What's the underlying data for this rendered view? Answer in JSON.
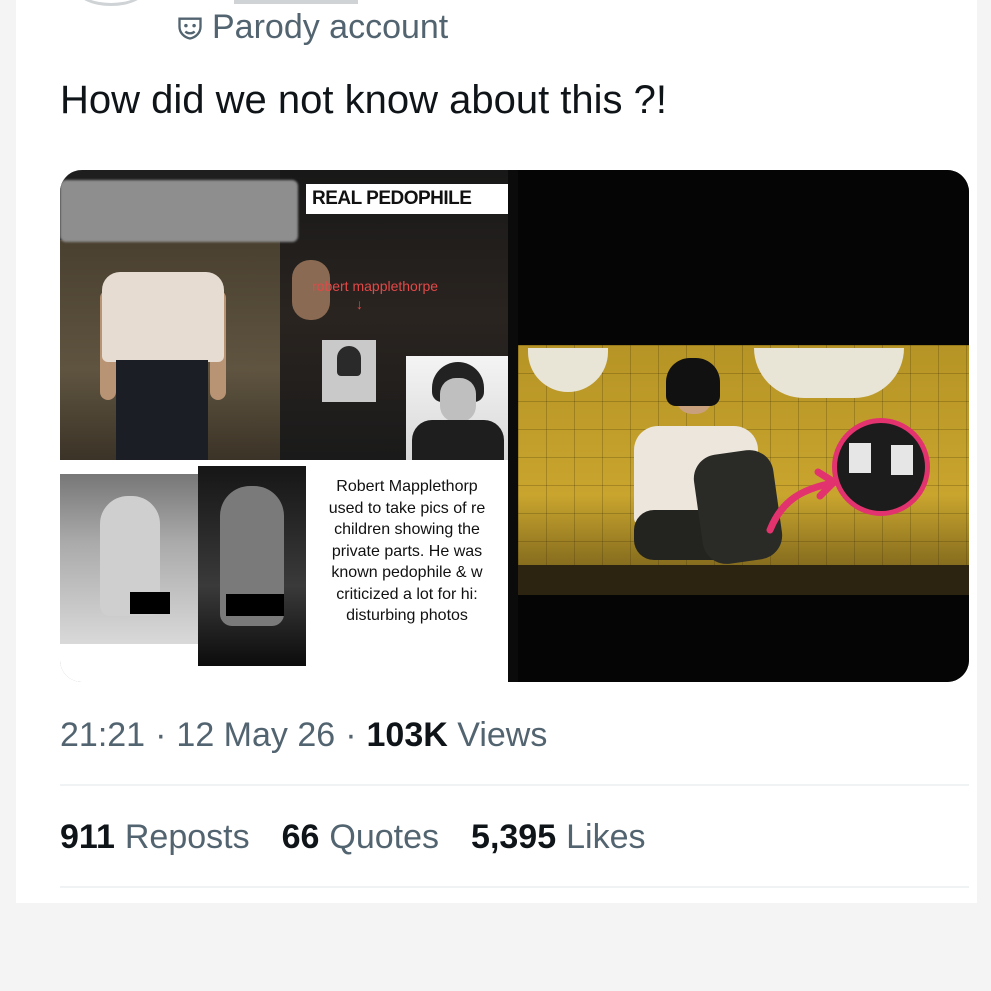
{
  "post": {
    "badge_text": "Parody account",
    "badge_icon": "parody-mask-icon",
    "text": "How did we not know about this ?!",
    "time": "21:21",
    "date": "12 May 26",
    "views_count": "103K",
    "views_label": "Views",
    "separator": "·"
  },
  "media": {
    "left_image": {
      "header_label": "REAL PEDOPHILE",
      "name_label": "robert mapplethorpe",
      "arrow_label": "↓",
      "caption": "Robert Mapplethorp\nused to take pics of re\nchildren showing the\nprivate parts. He was\nknown  pedophile & w\ncriticized a lot for hi:\ndisturbing photos"
    }
  },
  "stats": [
    {
      "count": "911",
      "label": "Reposts"
    },
    {
      "count": "66",
      "label": "Quotes"
    },
    {
      "count": "5,395",
      "label": "Likes"
    }
  ],
  "colors": {
    "text_primary": "#0f1419",
    "text_secondary": "#536471",
    "highlight_circle": "#e2336f",
    "annotation_red": "#e34848"
  }
}
